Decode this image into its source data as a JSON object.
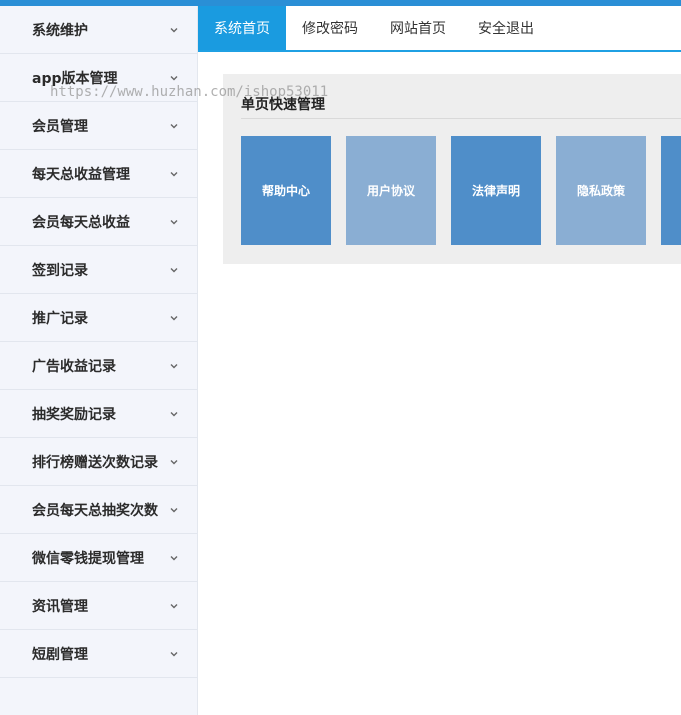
{
  "sidebar": {
    "items": [
      {
        "label": "系统维护"
      },
      {
        "label": "app版本管理"
      },
      {
        "label": "会员管理"
      },
      {
        "label": "每天总收益管理"
      },
      {
        "label": "会员每天总收益"
      },
      {
        "label": "签到记录"
      },
      {
        "label": "推广记录"
      },
      {
        "label": "广告收益记录"
      },
      {
        "label": "抽奖奖励记录"
      },
      {
        "label": "排行榜赠送次数记录"
      },
      {
        "label": "会员每天总抽奖次数"
      },
      {
        "label": "微信零钱提现管理"
      },
      {
        "label": "资讯管理"
      },
      {
        "label": "短剧管理"
      }
    ]
  },
  "nav": {
    "tabs": [
      {
        "label": "系统首页",
        "active": true
      },
      {
        "label": "修改密码",
        "active": false
      },
      {
        "label": "网站首页",
        "active": false
      },
      {
        "label": "安全退出",
        "active": false
      }
    ]
  },
  "panel": {
    "title": "单页快速管理",
    "tiles": [
      {
        "label": "帮助中心",
        "color": "#4f8ec9"
      },
      {
        "label": "用户协议",
        "color": "#8aaed3"
      },
      {
        "label": "法律声明",
        "color": "#4f8ec9"
      },
      {
        "label": "隐私政策",
        "color": "#8aaed3"
      },
      {
        "label": "",
        "color": "#4f8ec9"
      }
    ]
  },
  "watermark": {
    "text": "https://www.huzhan.com/ishop53011"
  },
  "colors": {
    "accent": "#1a9be0",
    "sidebar_bg": "#f3f5fb",
    "panel_bg": "#eeeeee"
  }
}
